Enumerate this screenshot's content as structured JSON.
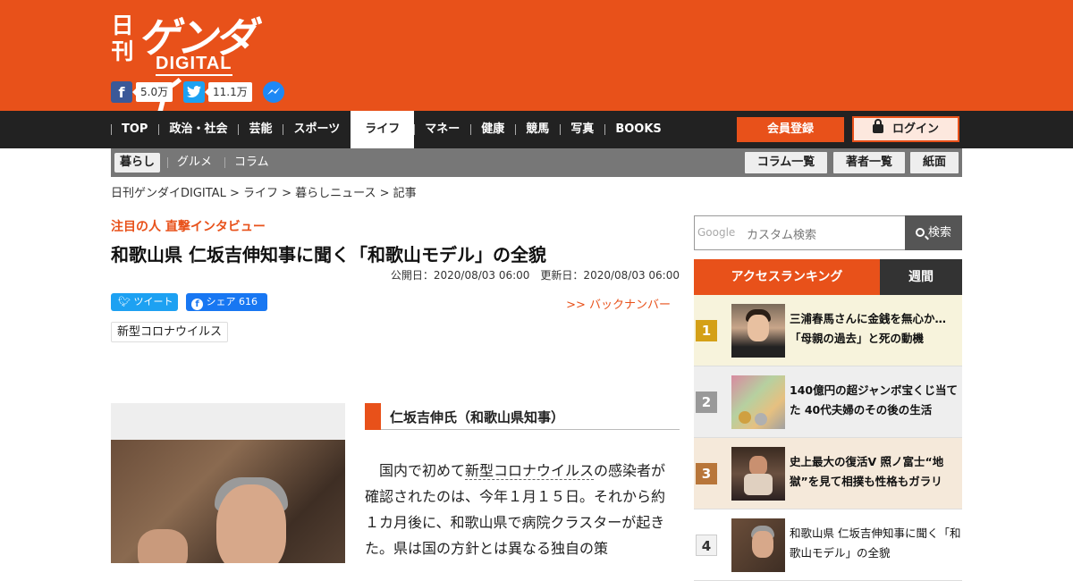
{
  "logo": {
    "kanji": "日刊",
    "main": "ゲンダイ",
    "sub": "DIGITAL"
  },
  "social": {
    "facebook_count": "5.0万",
    "twitter_count": "11.1万"
  },
  "nav": {
    "items": [
      "TOP",
      "政治・社会",
      "芸能",
      "スポーツ",
      "ライフ",
      "マネー",
      "健康",
      "競馬",
      "写真",
      "BOOKS"
    ],
    "active": "ライフ",
    "register": "会員登録",
    "login": "ログイン"
  },
  "subnav": {
    "items": [
      "暮らし",
      "グルメ",
      "コラム"
    ],
    "buttons": [
      "コラム一覧",
      "著者一覧",
      "紙面"
    ]
  },
  "breadcrumb": "日刊ゲンダイDIGITAL > ライフ > 暮らしニュース > 記事",
  "article": {
    "kicker": "注目の人 直撃インタビュー",
    "title": "和歌山県 仁坂吉伸知事に聞く「和歌山モデル」の全貌",
    "dates": "公開日：2020/08/03 06:00　更新日：2020/08/03 06:00",
    "tweet_label": "ツイート",
    "share_label": "シェア 616",
    "back_number": ">> バックナンバー",
    "tag": "新型コロナウイルス",
    "section_heading": "仁坂吉伸氏（和歌山県知事）",
    "body_pre": "国内で初めて",
    "body_link": "新型コロナウイルス",
    "body_post": "の感染者が確認されたのは、今年１月１５日。それから約１カ月後に、和歌山県で病院クラスターが起きた。県は国の方針とは異なる独自の策"
  },
  "search": {
    "google": "Google",
    "placeholder": "カスタム検索",
    "button": "検索"
  },
  "ranking": {
    "tab_main": "アクセスランキング",
    "tab_period": "週間",
    "items": [
      {
        "rank": "1",
        "title": "三浦春馬さんに金銭を無心か…「母親の過去」と死の動機",
        "color": "#d4a017",
        "bg": "#f7f3dc"
      },
      {
        "rank": "2",
        "title": "140億円の超ジャンボ宝くじ当てた 40代夫婦のその後の生活",
        "color": "#999999",
        "bg": "#eeeeee"
      },
      {
        "rank": "3",
        "title": "史上最大の復活V 照ノ富士“地獄”を見て相撲も性格もガラリ",
        "color": "#b8763a",
        "bg": "#f5e9da"
      },
      {
        "rank": "4",
        "title": "和歌山県 仁坂吉伸知事に聞く「和歌山モデル」の全貌",
        "color": "#333333",
        "bg": "#ffffff"
      }
    ]
  }
}
